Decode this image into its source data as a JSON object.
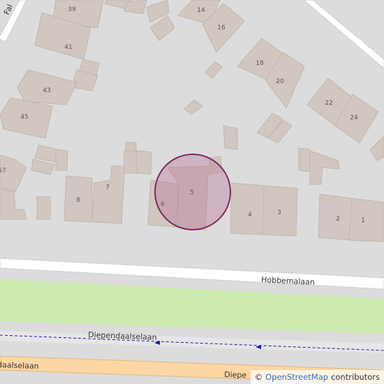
{
  "map": {
    "house_numbers": [
      "39",
      "14",
      "16",
      "41",
      "18",
      "20",
      "43",
      "22",
      "24",
      "45",
      "7",
      "8",
      "5",
      "6",
      "4",
      "3",
      "2",
      "1",
      "57"
    ],
    "streets": {
      "hobbemalaan": "Hobbemalaan",
      "diependaalselaan_small": "Diependaalselaan",
      "diependaalselaan_main_left": "daalselaan",
      "diependaalselaan_main_right": "Diepe",
      "top_left_street": "Fal"
    },
    "colors": {
      "background": "#dcdcdc",
      "building": "#d1c7c0",
      "building_stroke": "#c2b6ad",
      "road": "#ffffff",
      "grass": "#cdebb0",
      "main_road": "#fcd6a4",
      "path": "#1a1aa8",
      "marker_fill": "#b05a8c",
      "marker_stroke": "#7a2a5e"
    }
  },
  "attribution": {
    "symbol": "©",
    "link": "OpenStreetMap",
    "suffix": "contributors"
  }
}
